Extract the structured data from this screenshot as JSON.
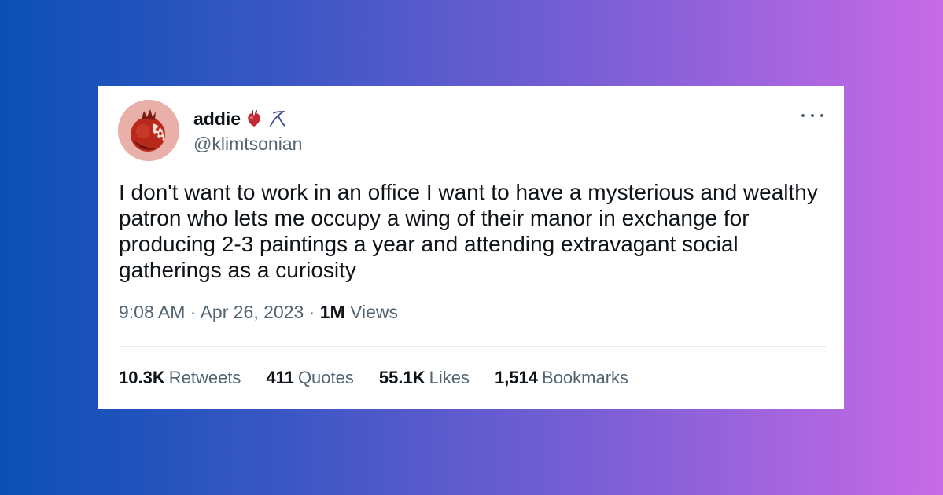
{
  "user": {
    "display_name": "addie",
    "handle": "@klimtsonian",
    "emoji_1": "anatomical-heart-icon",
    "emoji_2": "scribble-icon"
  },
  "tweet": {
    "text": "I don't want to work in an office I want to have a mysterious and wealthy patron who lets me occupy a wing of their manor in exchange for producing 2-3 paintings a year and attending extravagant social gatherings as a curiosity",
    "time": "9:08 AM",
    "sep": "·",
    "date": "Apr 26, 2023",
    "views_count": "1M",
    "views_label": "Views"
  },
  "stats": [
    {
      "count": "10.3K",
      "label": "Retweets"
    },
    {
      "count": "411",
      "label": "Quotes"
    },
    {
      "count": "55.1K",
      "label": "Likes"
    },
    {
      "count": "1,514",
      "label": "Bookmarks"
    }
  ],
  "colors": {
    "text_primary": "#0f1419",
    "text_secondary": "#536471",
    "avatar_bg": "#e8b0a8",
    "pomegranate": "#b8291c"
  }
}
